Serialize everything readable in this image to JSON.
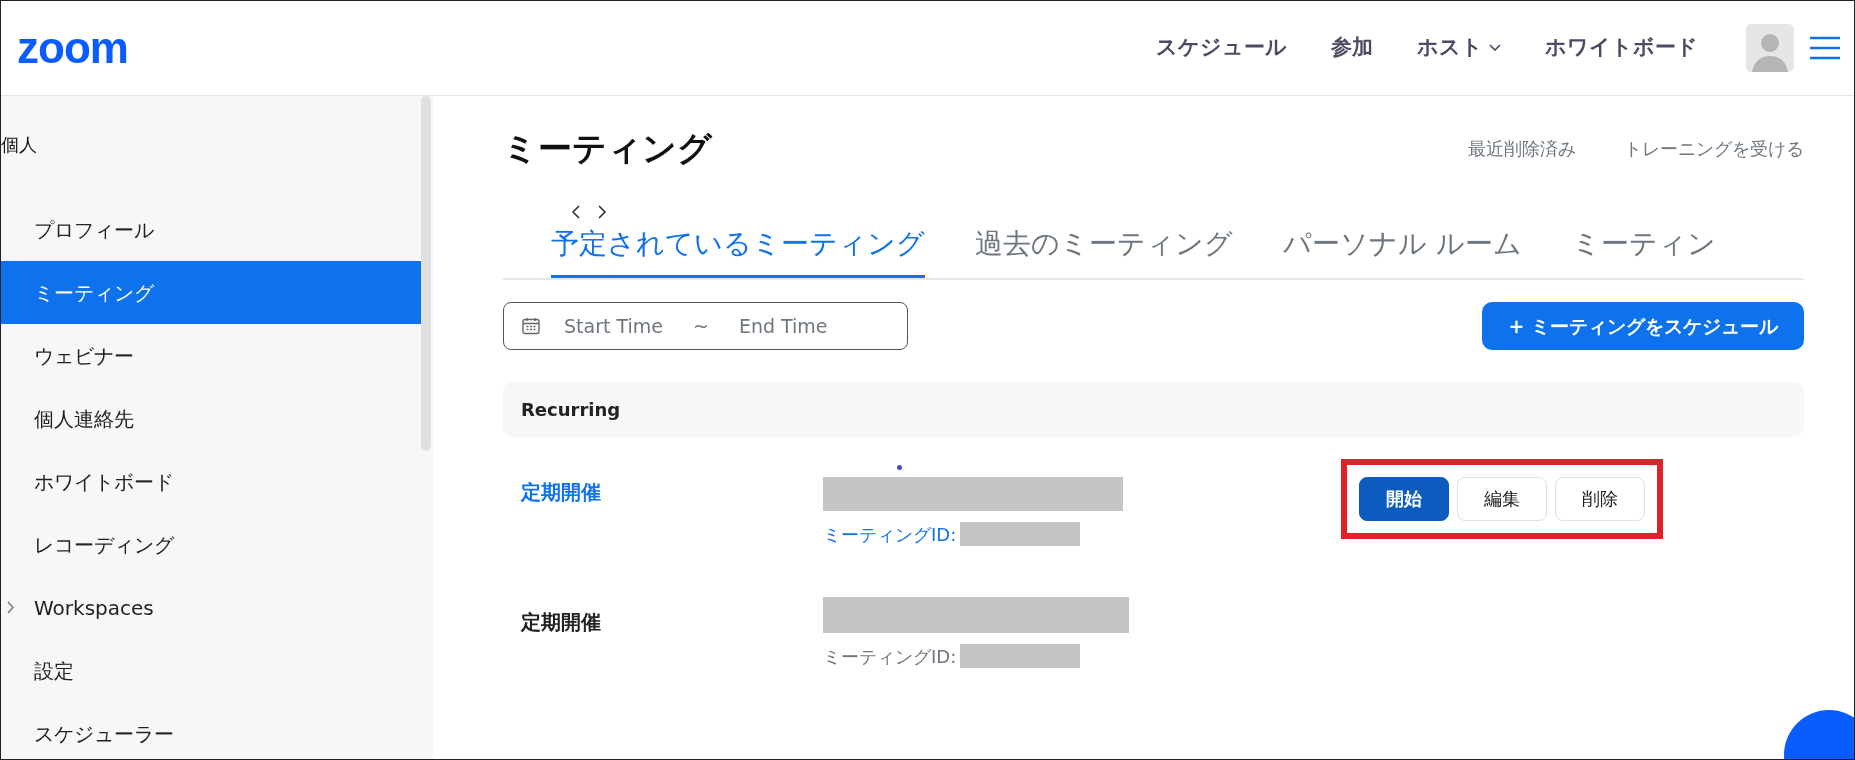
{
  "header": {
    "logo": "zoom",
    "nav": [
      {
        "label": "スケジュール",
        "dropdown": false
      },
      {
        "label": "参加",
        "dropdown": false
      },
      {
        "label": "ホスト",
        "dropdown": true
      },
      {
        "label": "ホワイトボード",
        "dropdown": false
      }
    ]
  },
  "sidebar": {
    "heading": "個人",
    "items": [
      {
        "label": "プロフィール",
        "selected": false,
        "expandable": false
      },
      {
        "label": "ミーティング",
        "selected": true,
        "expandable": false
      },
      {
        "label": "ウェビナー",
        "selected": false,
        "expandable": false
      },
      {
        "label": "個人連絡先",
        "selected": false,
        "expandable": false
      },
      {
        "label": "ホワイトボード",
        "selected": false,
        "expandable": false
      },
      {
        "label": "レコーディング",
        "selected": false,
        "expandable": false
      },
      {
        "label": "Workspaces",
        "selected": false,
        "expandable": true
      },
      {
        "label": "設定",
        "selected": false,
        "expandable": false
      },
      {
        "label": "スケジューラー",
        "selected": false,
        "expandable": false
      }
    ]
  },
  "page": {
    "title": "ミーティング",
    "links": [
      "最近削除済み",
      "トレーニングを受ける"
    ]
  },
  "tabs": [
    {
      "label": "予定されているミーティング",
      "selected": true
    },
    {
      "label": "過去のミーティング",
      "selected": false
    },
    {
      "label": "パーソナル ルーム",
      "selected": false
    },
    {
      "label": "ミーティン",
      "selected": false
    }
  ],
  "filter": {
    "start_placeholder": "Start Time",
    "separator": "~",
    "end_placeholder": "End Time"
  },
  "schedule_button": "+ ミーティングをスケジュール",
  "group": {
    "title": "Recurring"
  },
  "meetings": [
    {
      "title": "定期開催",
      "id_label": "ミーティングID:",
      "highlighted": true,
      "actions": [
        {
          "label": "開始",
          "primary": true
        },
        {
          "label": "編集",
          "primary": false
        },
        {
          "label": "削除",
          "primary": false
        }
      ]
    },
    {
      "title": "定期開催",
      "id_label": "ミーティングID:",
      "highlighted": false
    }
  ]
}
